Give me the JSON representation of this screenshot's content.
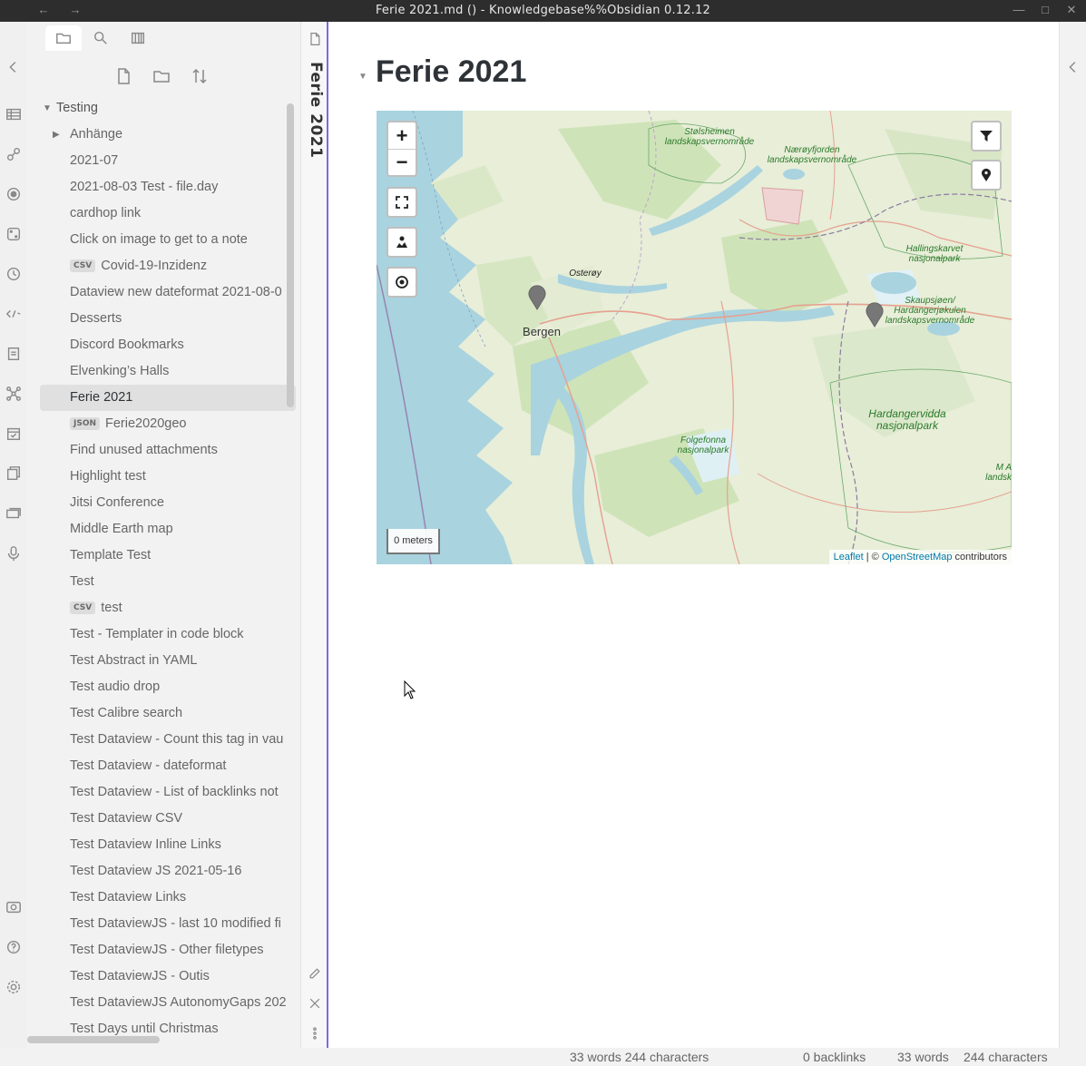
{
  "window": {
    "title": "Ferie 2021.md () - Knowledgebase%%Obsidian 0.12.12"
  },
  "ribbon": {
    "icons": [
      "chevron-left-icon",
      "table-icon",
      "link-icon",
      "graph-target-icon",
      "dice-icon",
      "clock-icon",
      "template-code-icon",
      "document-icon",
      "graph-network-icon",
      "calendar-check-icon",
      "copy-doc-icon",
      "slides-icon",
      "microphone-icon",
      "vault-icon",
      "help-icon",
      "settings-icon"
    ]
  },
  "sidebar": {
    "tabs": [
      "folder-icon",
      "search-icon",
      "bookmark-book-icon"
    ],
    "actions": [
      "new-note-icon",
      "new-folder-icon",
      "sort-icon"
    ],
    "root_folder": "Testing",
    "items": [
      {
        "label": "Anhänge",
        "type": "folder"
      },
      {
        "label": "2021-07",
        "type": "file"
      },
      {
        "label": "2021-08-03 Test - file.day",
        "type": "file"
      },
      {
        "label": "cardhop link",
        "type": "file"
      },
      {
        "label": "Click on image to get to a note",
        "type": "file"
      },
      {
        "label": "Covid-19-Inzidenz",
        "type": "file",
        "tag": "CSV"
      },
      {
        "label": "Dataview new dateformat 2021-08-0",
        "type": "file"
      },
      {
        "label": "Desserts",
        "type": "file"
      },
      {
        "label": "Discord Bookmarks",
        "type": "file"
      },
      {
        "label": "Elvenking’s Halls",
        "type": "file"
      },
      {
        "label": "Ferie 2021",
        "type": "file",
        "active": true
      },
      {
        "label": "Ferie2020geo",
        "type": "file",
        "tag": "JSON"
      },
      {
        "label": "Find unused attachments",
        "type": "file"
      },
      {
        "label": "Highlight test",
        "type": "file"
      },
      {
        "label": "Jitsi Conference",
        "type": "file"
      },
      {
        "label": "Middle Earth map",
        "type": "file"
      },
      {
        "label": "Template Test",
        "type": "file"
      },
      {
        "label": "Test",
        "type": "file"
      },
      {
        "label": "test",
        "type": "file",
        "tag": "CSV"
      },
      {
        "label": "Test - Templater in code block",
        "type": "file"
      },
      {
        "label": "Test Abstract in YAML",
        "type": "file"
      },
      {
        "label": "Test audio drop",
        "type": "file"
      },
      {
        "label": "Test Calibre search",
        "type": "file"
      },
      {
        "label": "Test Dataview - Count this tag in vau",
        "type": "file"
      },
      {
        "label": "Test Dataview - dateformat",
        "type": "file"
      },
      {
        "label": "Test Dataview - List of backlinks not",
        "type": "file"
      },
      {
        "label": "Test Dataview CSV",
        "type": "file"
      },
      {
        "label": "Test Dataview Inline Links",
        "type": "file"
      },
      {
        "label": "Test Dataview JS 2021-05-16",
        "type": "file"
      },
      {
        "label": "Test Dataview Links",
        "type": "file"
      },
      {
        "label": "Test DataviewJS - last 10 modified fi",
        "type": "file"
      },
      {
        "label": "Test DataviewJS - Other filetypes",
        "type": "file"
      },
      {
        "label": "Test DataviewJS - Outis",
        "type": "file"
      },
      {
        "label": "Test DataviewJS AutonomyGaps 202",
        "type": "file"
      },
      {
        "label": "Test Days until Christmas",
        "type": "file"
      }
    ]
  },
  "tabstrip": {
    "title": "Ferie 2021"
  },
  "note": {
    "heading": "Ferie 2021"
  },
  "map": {
    "zoom_in": "+",
    "zoom_out": "−",
    "scale": "0 meters",
    "attribution_leaflet": "Leaflet",
    "attribution_sep": " | © ",
    "attribution_osm": "OpenStreetMap",
    "attribution_tail": " contributors",
    "labels": {
      "stolsheimen": "Stølsheimen landskapsvernområde",
      "naeroy": "Nærøyfjorden landskapsvernområde",
      "hallingskarvet": "Hallingskarvet nasjonalpark",
      "skaupsjoen": "Skaupsjøen/ Hardangerjøkulen landskapsvernområde",
      "osteroy": "Osterøy",
      "bergen": "Bergen",
      "hardangervidda": "Hardangervidda nasjonalpark",
      "folgefonna": "Folgefonna nasjonalpark",
      "edge": "M A landsk"
    },
    "markers": 2
  },
  "status": {
    "left": "33 words 244 characters",
    "backlinks": "0 backlinks",
    "words": "33 words",
    "chars": "244 characters"
  },
  "colors": {
    "accent": "#7b6cd9",
    "water": "#a9d3df",
    "land": "#e8eed8",
    "forest": "#cfe3b8"
  }
}
